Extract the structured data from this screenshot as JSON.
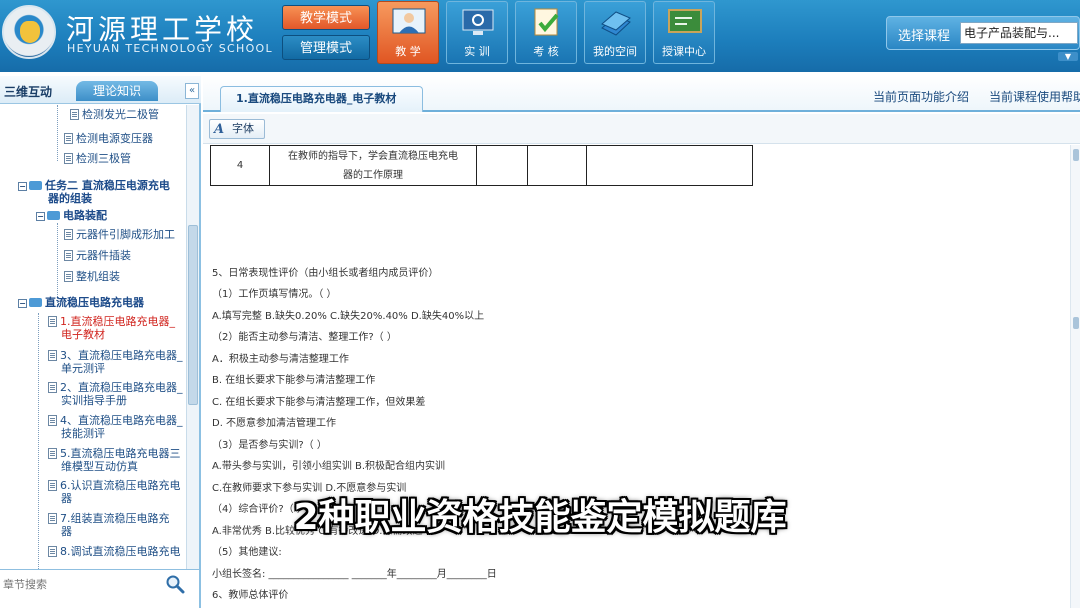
{
  "header": {
    "school_name": "河源理工学校",
    "school_name_en": "HEYUAN TECHNOLOGY SCHOOL",
    "modes": {
      "teach": "教学模式",
      "manage": "管理模式"
    },
    "nav": [
      {
        "label": "教 学",
        "icon": "teacher-icon"
      },
      {
        "label": "实 训",
        "icon": "monitor-gear-icon"
      },
      {
        "label": "考 核",
        "icon": "exam-check-icon"
      },
      {
        "label": "我的空间",
        "icon": "books-icon"
      },
      {
        "label": "授课中心",
        "icon": "chalkboard-icon"
      }
    ],
    "course": {
      "label": "选择课程",
      "value": "电子产品装配与..."
    }
  },
  "sidebar": {
    "tab_3d": "三维互动",
    "tab_theory": "理论知识",
    "collapse": "«",
    "tree": {
      "item_led": "检测发光二极管",
      "item_transformer": "检测电源变压器",
      "item_transistor": "检测三极管",
      "task2": "任务二  直流稳压电源充电",
      "task2_cont": "器的组装",
      "circuit": "电路装配",
      "item_lead": "元器件引脚成形加工",
      "item_insert": "元器件插装",
      "item_assembly": "整机组装",
      "charger": "直流稳压电路充电器",
      "doc1_a": "1.直流稳压电路充电器_",
      "doc1_b": "电子教材",
      "doc3_a": "3、直流稳压电路充电器_",
      "doc3_b": "单元测评",
      "doc2_a": "2、直流稳压电路充电器_",
      "doc2_b": "实训指导手册",
      "doc4_a": "4、直流稳压电路充电器_",
      "doc4_b": "技能测评",
      "doc5_a": "5.直流稳压电路充电器三",
      "doc5_b": "维模型互动仿真",
      "doc6_a": "6.认识直流稳压电路充电",
      "doc6_b": "器",
      "doc7_a": "7.组装直流稳压电路充",
      "doc7_b": "器",
      "doc8_a": "8.调试直流稳压电路充电"
    },
    "search_placeholder": "章节搜索"
  },
  "main": {
    "tab_title": "1.直流稳压电路充电器_电子教材",
    "intro_link": "当前页面功能介绍",
    "course_help_link": "当前课程使用帮助",
    "font_button": "字体",
    "table": {
      "no": "4",
      "text_a": "在教师的指导下，学会直流稳压电充电",
      "text_b": "器的工作原理"
    },
    "doc_lines": [
      "5、日常表现性评价（由小组长或者组内成员评价）",
      "（1）工作页填写情况。（  ）",
      "A.填写完整  B.缺失0.20%  C.缺失20%.40%  D.缺失40%以上",
      "（2）能否主动参与清洁、整理工作?（  ）",
      "A．积极主动参与清洁整理工作",
      "B.  在组长要求下能参与清洁整理工作",
      "C.  在组长要求下能参与清洁整理工作，但效果差",
      "D.  不愿意参加清洁管理工作",
      "（3）是否参与实训?（  ）",
      "A.带头参与实训，引领小组实训  B.积极配合组内实训",
      "C.在教师要求下参与实训  D.不愿意参与实训",
      "（4）综合评价?（  ）",
      "A.非常优秀  B.比较优秀  C.有待改进  D.急需改进",
      "（5）其他建议:",
      "小组长签名:  ________________   _______年________月________日",
      "6、教师总体评价"
    ]
  },
  "subtitle": "2种职业资格技能鉴定模拟题库",
  "colors": {
    "header_blue": "#1d7fbd",
    "active_orange": "#e05623",
    "link_blue": "#1a4a7e",
    "current_red": "#d1251f"
  }
}
